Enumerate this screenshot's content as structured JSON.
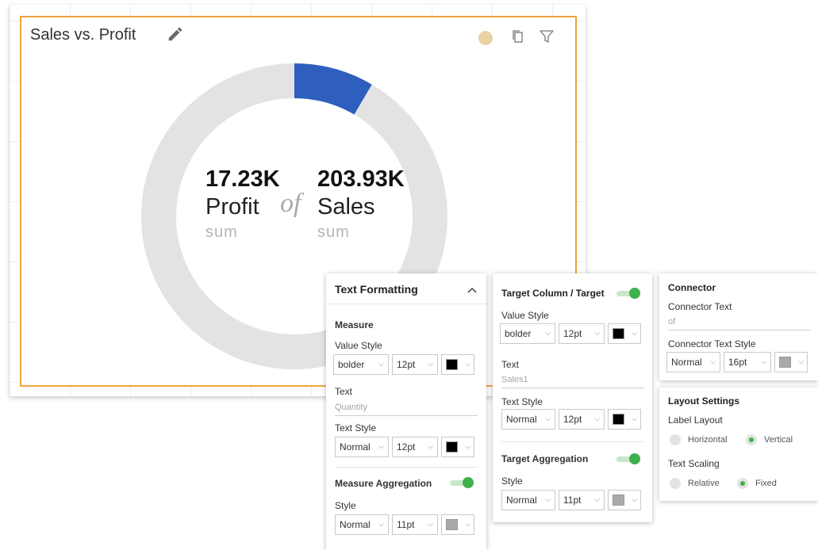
{
  "card": {
    "title": "Sales vs. Profit",
    "actions": [
      "edit-icon",
      "status-dot",
      "copy-icon",
      "filter-icon"
    ],
    "status_dot_color": "#e7d3a3",
    "border_color": "#f0a23c"
  },
  "kpi": {
    "measure_value": "17.23K",
    "measure_name": "Profit",
    "measure_agg": "sum",
    "connector": "of",
    "target_value": "203.93K",
    "target_name": "Sales",
    "target_agg": "sum",
    "progress_ratio": 0.0845,
    "progress_color": "#2e5fbf",
    "track_color": "#e3e3e3"
  },
  "text_formatting": {
    "header": "Text Formatting",
    "measure": {
      "title": "Measure",
      "value_style_label": "Value Style",
      "weight": "bolder",
      "size": "12pt",
      "color": "#000000",
      "text_label": "Text",
      "text_placeholder": "Quantity",
      "text_style_label": "Text Style",
      "text_weight": "Normal",
      "text_size": "12pt",
      "text_color": "#000000"
    },
    "aggregation": {
      "title": "Measure Aggregation",
      "style_label": "Style",
      "weight": "Normal",
      "size": "11pt",
      "color": "#a9a9a9"
    }
  },
  "target_panel": {
    "header": "Target Column / Target",
    "value_style_label": "Value Style",
    "weight": "bolder",
    "size": "12pt",
    "color": "#000000",
    "text_label": "Text",
    "text_placeholder": "Sales1",
    "text_style_label": "Text Style",
    "text_weight": "Normal",
    "text_size": "12pt",
    "text_color": "#000000",
    "aggregation_title": "Target Aggregation",
    "agg_style_label": "Style",
    "agg_weight": "Normal",
    "agg_size": "11pt",
    "agg_color": "#a9a9a9"
  },
  "connector_panel": {
    "header": "Connector",
    "text_label": "Connector Text",
    "text_value": "of",
    "style_label": "Connector Text Style",
    "weight": "Normal",
    "size": "16pt",
    "color": "#a9a9a9"
  },
  "layout_settings": {
    "header": "Layout Settings",
    "label_layout_label": "Label Layout",
    "horizontal": "Horizontal",
    "vertical": "Vertical",
    "label_layout_selected": "Vertical",
    "text_scaling_label": "Text Scaling",
    "relative": "Relative",
    "fixed": "Fixed",
    "text_scaling_selected": "Fixed"
  }
}
